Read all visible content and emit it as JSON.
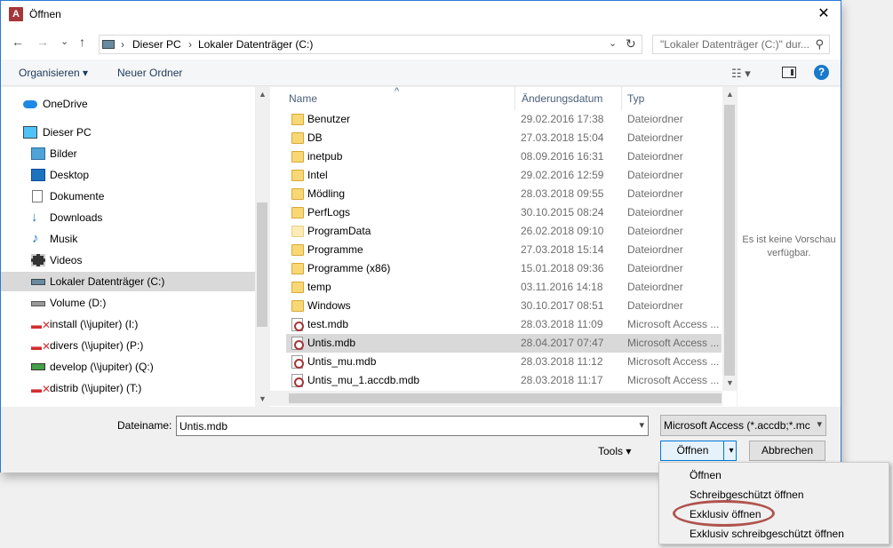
{
  "window": {
    "title": "Öffnen",
    "app_icon_letter": "A",
    "close_glyph": "✕"
  },
  "navigation": {
    "back_glyph": "←",
    "forward_glyph": "→",
    "recent_glyph": "⌄",
    "up_glyph": "↑",
    "breadcrumb_separator": "›",
    "breadcrumb": [
      "Dieser PC",
      "Lokaler Datenträger (C:)"
    ],
    "search_placeholder": "\"Lokaler Datenträger (C:)\" dur..."
  },
  "toolbar": {
    "organize_label": "Organisieren ▾",
    "new_folder_label": "Neuer Ordner",
    "view_glyph": "☷ ▾",
    "help_glyph": "?"
  },
  "sidebar": {
    "items": [
      {
        "label": "OneDrive",
        "icon": "cloud-icon"
      },
      {
        "label": "Dieser PC",
        "icon": "computer-icon"
      },
      {
        "label": "Bilder",
        "icon": "pictures-icon"
      },
      {
        "label": "Desktop",
        "icon": "desktop-icon"
      },
      {
        "label": "Dokumente",
        "icon": "documents-icon"
      },
      {
        "label": "Downloads",
        "icon": "downloads-icon"
      },
      {
        "label": "Musik",
        "icon": "music-icon"
      },
      {
        "label": "Videos",
        "icon": "videos-icon"
      },
      {
        "label": "Lokaler Datenträger (C:)",
        "icon": "drive-icon"
      },
      {
        "label": "Volume (D:)",
        "icon": "drive-icon"
      },
      {
        "label": "install (\\\\jupiter) (I:)",
        "icon": "network-drive-disconnected-icon"
      },
      {
        "label": "divers (\\\\jupiter) (P:)",
        "icon": "network-drive-disconnected-icon"
      },
      {
        "label": "develop (\\\\jupiter) (Q:)",
        "icon": "network-drive-icon"
      },
      {
        "label": "distrib (\\\\jupiter) (T:)",
        "icon": "network-drive-disconnected-icon"
      }
    ]
  },
  "file_list": {
    "columns": [
      "Name",
      "Änderungsdatum",
      "Typ"
    ],
    "sort_glyph": "^",
    "rows": [
      {
        "name": "Benutzer",
        "date": "29.02.2016 17:38",
        "type": "Dateiordner",
        "kind": "folder"
      },
      {
        "name": "DB",
        "date": "27.03.2018 15:04",
        "type": "Dateiordner",
        "kind": "folder"
      },
      {
        "name": "inetpub",
        "date": "08.09.2016 16:31",
        "type": "Dateiordner",
        "kind": "folder"
      },
      {
        "name": "Intel",
        "date": "29.02.2016 12:59",
        "type": "Dateiordner",
        "kind": "folder"
      },
      {
        "name": "Mödling",
        "date": "28.03.2018 09:55",
        "type": "Dateiordner",
        "kind": "folder"
      },
      {
        "name": "PerfLogs",
        "date": "30.10.2015 08:24",
        "type": "Dateiordner",
        "kind": "folder"
      },
      {
        "name": "ProgramData",
        "date": "26.02.2018 09:10",
        "type": "Dateiordner",
        "kind": "folder-light"
      },
      {
        "name": "Programme",
        "date": "27.03.2018 15:14",
        "type": "Dateiordner",
        "kind": "folder"
      },
      {
        "name": "Programme (x86)",
        "date": "15.01.2018 09:36",
        "type": "Dateiordner",
        "kind": "folder"
      },
      {
        "name": "temp",
        "date": "03.11.2016 14:18",
        "type": "Dateiordner",
        "kind": "folder"
      },
      {
        "name": "Windows",
        "date": "30.10.2017 08:51",
        "type": "Dateiordner",
        "kind": "folder"
      },
      {
        "name": "test.mdb",
        "date": "28.03.2018 11:09",
        "type": "Microsoft Access ...",
        "kind": "mdb"
      },
      {
        "name": "Untis.mdb",
        "date": "28.04.2017 07:47",
        "type": "Microsoft Access ...",
        "kind": "mdb"
      },
      {
        "name": "Untis_mu.mdb",
        "date": "28.03.2018 11:12",
        "type": "Microsoft Access ...",
        "kind": "mdb"
      },
      {
        "name": "Untis_mu_1.accdb.mdb",
        "date": "28.03.2018 11:17",
        "type": "Microsoft Access ...",
        "kind": "mdb"
      }
    ]
  },
  "preview": {
    "line1": "Es ist keine Vorschau",
    "line2": "verfügbar."
  },
  "footer": {
    "filename_label": "Dateiname:",
    "filename_value": "Untis.mdb",
    "filetype_value": "Microsoft Access (*.accdb;*.mc",
    "tools_label": "Tools ▾",
    "open_label": "Öffnen",
    "cancel_label": "Abbrechen",
    "dropdown_glyph": "▾",
    "split_glyph": "▾"
  },
  "open_menu": {
    "items": [
      "Öffnen",
      "Schreibgeschützt öffnen",
      "Exklusiv öffnen",
      "Exklusiv schreibgeschützt öffnen"
    ]
  },
  "colors": {
    "accent": "#0078d7",
    "selection": "#d9d9d9",
    "annotation": "#b0534d"
  }
}
